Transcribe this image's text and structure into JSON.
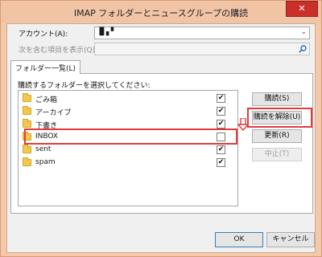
{
  "window": {
    "title": "IMAP フォルダーとニュースグループの購読",
    "close_glyph": "✕"
  },
  "account": {
    "label": "アカウント(A):",
    "value": "▐▌▖▘"
  },
  "search": {
    "label": "次を含む項目を表示(Q):",
    "value": ""
  },
  "tab": {
    "label": "フォルダー一覧(L)"
  },
  "list": {
    "label": "購読するフォルダーを選択してください:",
    "items": [
      {
        "name": "ごみ箱",
        "checked": "✔"
      },
      {
        "name": "アーカイブ",
        "checked": "✔"
      },
      {
        "name": "下書き",
        "checked": "✔"
      },
      {
        "name": "INBOX",
        "checked": ""
      },
      {
        "name": "sent",
        "checked": "✔"
      },
      {
        "name": "spam",
        "checked": "✔"
      }
    ]
  },
  "actions": {
    "subscribe": "購読(S)",
    "unsubscribe": "購読を解除(U)",
    "refresh": "更新(R)",
    "stop": "中止(T)"
  },
  "footer": {
    "ok": "OK",
    "cancel": "キャンセル"
  },
  "colors": {
    "highlight": "#e23b3b",
    "title_bar": "#f2c4a6",
    "close_button": "#c7302b"
  }
}
